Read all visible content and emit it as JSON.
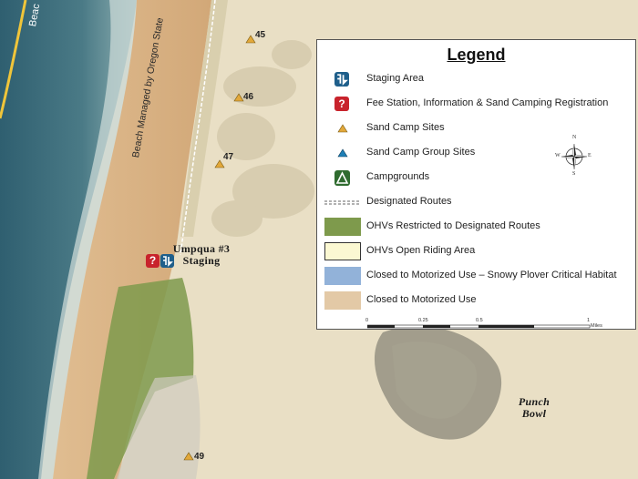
{
  "map": {
    "road_label": "Beac",
    "beach_label": "Beach Managed by Oregon State",
    "sites": [
      "45",
      "46",
      "47",
      "49"
    ],
    "staging_label_line1": "Umpqua #3",
    "staging_label_line2": "Staging",
    "punch_bowl_line1": "Punch",
    "punch_bowl_line2": "Bowl",
    "colors": {
      "ocean": "#3d6b79",
      "beach": "#d9b48a",
      "sand": "#e8dcc0",
      "ohv_restricted": "#7e9a4c",
      "sand_camp": "#e2a83a"
    }
  },
  "legend": {
    "title": "Legend",
    "items": [
      {
        "label": "Staging Area",
        "icon": "staging-area-icon"
      },
      {
        "label": "Fee Station, Information & Sand Camping Registration",
        "icon": "fee-station-icon"
      },
      {
        "label": "Sand Camp Sites",
        "icon": "orange-triangle-icon"
      },
      {
        "label": "Sand Camp Group Sites",
        "icon": "blue-triangle-icon"
      },
      {
        "label": "Campgrounds",
        "icon": "campground-icon"
      },
      {
        "label": "Designated Routes",
        "icon": "dashed-line-icon"
      },
      {
        "label": "OHVs Restricted to Designated Routes",
        "swatch": "#7e9a4c"
      },
      {
        "label": "OHVs Open Riding Area",
        "swatch": "#fbf8d2"
      },
      {
        "label": "Closed to Motorized Use – Snowy Plover Critical Habitat",
        "swatch": "#92b2d9"
      },
      {
        "label": "Closed to Motorized Use",
        "swatch": "#e3c9a6"
      }
    ],
    "compass": {
      "n": "N",
      "s": "S",
      "e": "E",
      "w": "W"
    },
    "scale": {
      "ticks": [
        "0",
        "0.25",
        "0.5",
        "1"
      ],
      "unit": "Miles"
    }
  }
}
